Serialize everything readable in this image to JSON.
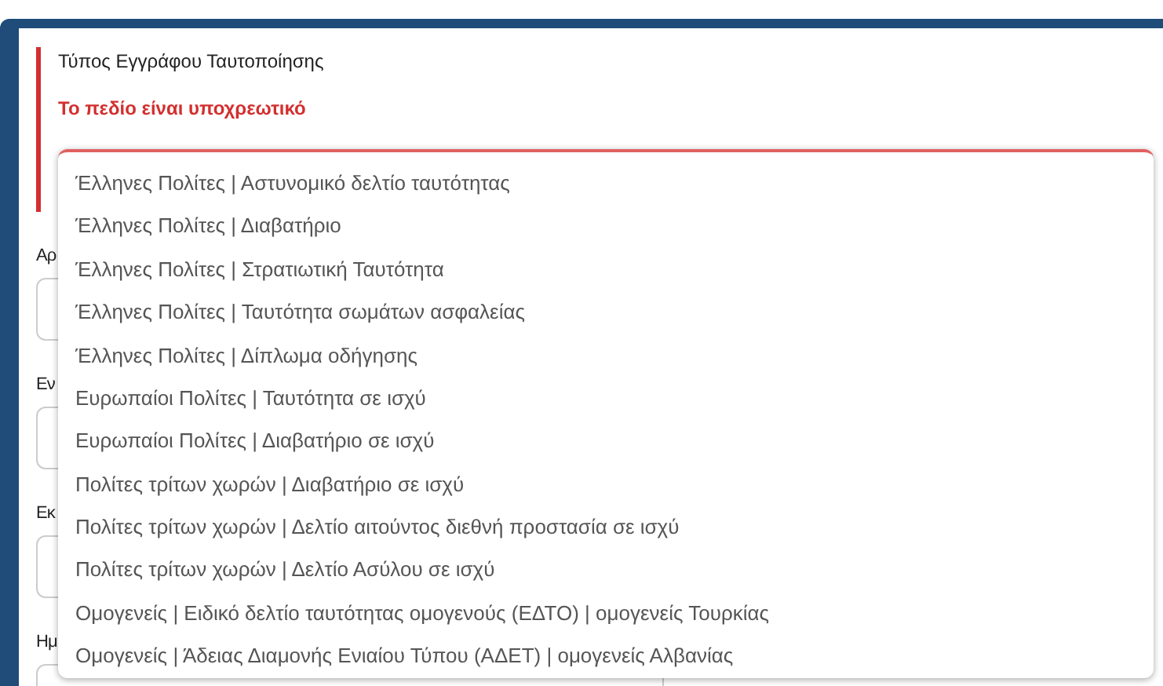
{
  "field": {
    "label": "Τύπος Εγγράφου Ταυτοποίησης",
    "error": "Το πεδίο είναι υποχρεωτικό",
    "options": [
      {
        "label": "Έλληνες Πολίτες | Αστυνομικό δελτίο ταυτότητας"
      },
      {
        "label": "Έλληνες Πολίτες | Διαβατήριο"
      },
      {
        "label": "Έλληνες Πολίτες | Στρατιωτική Ταυτότητα"
      },
      {
        "label": "Έλληνες Πολίτες | Ταυτότητα σωμάτων ασφαλείας"
      },
      {
        "label": "Έλληνες Πολίτες | Δίπλωμα οδήγησης"
      },
      {
        "label": "Ευρωπαίοι Πολίτες | Ταυτότητα σε ισχύ"
      },
      {
        "label": "Ευρωπαίοι Πολίτες | Διαβατήριο σε ισχύ"
      },
      {
        "label": "Πολίτες τρίτων χωρών | Διαβατήριο σε ισχύ"
      },
      {
        "label": "Πολίτες τρίτων χωρών | Δελτίο αιτούντος διεθνή προστασία σε ισχύ"
      },
      {
        "label": "Πολίτες τρίτων χωρών | Δελτίο Ασύλου σε ισχύ"
      },
      {
        "label": "Ομογενείς | Ειδικό δελτίο ταυτότητας ομογενούς (ΕΔΤΟ) | ομογενείς Τουρκίας"
      },
      {
        "label": "Ομογενείς | Άδειας Διαμονής Ενιαίου Τύπου (ΑΔΕΤ) | ομογενείς Αλβανίας"
      }
    ]
  },
  "background_fields": [
    {
      "label": "Αρ"
    },
    {
      "label": "Εν"
    },
    {
      "label": "Εκ"
    },
    {
      "label": "Ημ"
    }
  ]
}
